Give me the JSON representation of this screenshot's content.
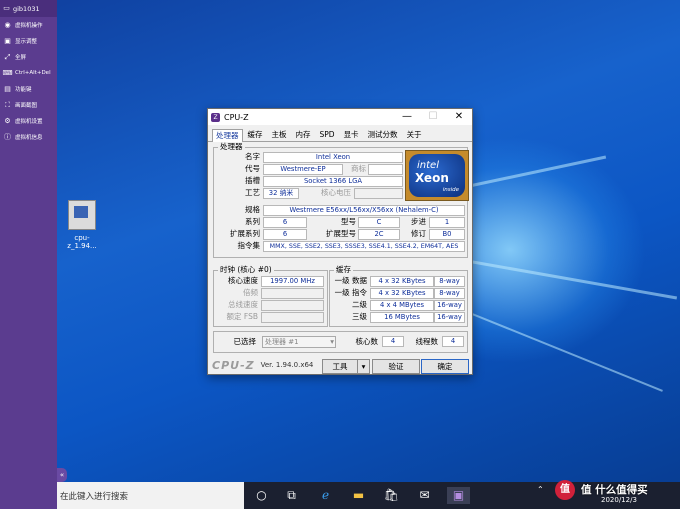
{
  "sidebar": {
    "title": "gib1031",
    "items": [
      {
        "icon": "vm-icon",
        "label": "虚拟机操作"
      },
      {
        "icon": "display-icon",
        "label": "显示调整"
      },
      {
        "icon": "fullscreen-icon",
        "label": "全屏"
      },
      {
        "icon": "keyboard-icon",
        "label": "Ctrl+Alt+Del"
      },
      {
        "icon": "function-key-icon",
        "label": "功能键"
      },
      {
        "icon": "screenshot-icon",
        "label": "画面截图"
      },
      {
        "icon": "gear-icon",
        "label": "虚拟机设置"
      },
      {
        "icon": "info-icon",
        "label": "虚拟机信息"
      }
    ],
    "handle": "«"
  },
  "desktop": {
    "icon_label": "cpu-z_1.94..."
  },
  "window": {
    "title": "CPU-Z",
    "logo": "Z",
    "controls": {
      "minimize": "—",
      "maximize": "☐",
      "close": "✕"
    },
    "tabs": [
      "处理器",
      "缓存",
      "主板",
      "内存",
      "SPD",
      "显卡",
      "测试分数",
      "关于"
    ],
    "processor": {
      "group_title": "处理器",
      "name_label": "名字",
      "name": "Intel Xeon",
      "codename_label": "代号",
      "codename": "Westmere-EP",
      "brand_label": "商标",
      "brand": "",
      "package_label": "插槽",
      "package": "Socket 1366 LGA",
      "tech_label": "工艺",
      "tech": "32 纳米",
      "voltage_label": "核心电压",
      "voltage": "",
      "spec_label": "规格",
      "spec": "Westmere E56xx/L56xx/X56xx (Nehalem-C)",
      "family_label": "系列",
      "family": "6",
      "model_label": "型号",
      "model": "C",
      "stepping_label": "步进",
      "stepping": "1",
      "extfamily_label": "扩展系列",
      "extfamily": "6",
      "extmodel_label": "扩展型号",
      "extmodel": "2C",
      "revision_label": "修订",
      "revision": "B0",
      "instructions_label": "指令集",
      "instructions": "MMX, SSE, SSE2, SSE3, SSSE3, SSE4.1, SSE4.2, EM64T, AES",
      "badge": {
        "line1": "intel",
        "line2": "Xeon",
        "line3": "inside"
      }
    },
    "clocks": {
      "group_title": "时钟 (核心 #0)",
      "core_speed_label": "核心速度",
      "core_speed": "1997.00 MHz",
      "multiplier_label": "倍频",
      "multiplier": "",
      "bus_label": "总线速度",
      "bus": "",
      "fsb_label": "额定 FSB",
      "fsb": ""
    },
    "cache": {
      "group_title": "缓存",
      "rows": [
        {
          "label": "一级 数据",
          "size": "4 x 32 KBytes",
          "way": "8-way"
        },
        {
          "label": "一级 指令",
          "size": "4 x 32 KBytes",
          "way": "8-way"
        },
        {
          "label": "二级",
          "size": "4 x 4 MBytes",
          "way": "16-way"
        },
        {
          "label": "三级",
          "size": "16 MBytes",
          "way": "16-way"
        }
      ]
    },
    "selection": {
      "label": "已选择",
      "value": "处理器 #1",
      "cores_label": "核心数",
      "cores": "4",
      "threads_label": "线程数",
      "threads": "4"
    },
    "footer": {
      "brand": "CPU-Z",
      "version": "Ver. 1.94.0.x64",
      "tools": "工具",
      "validate": "验证",
      "ok": "确定"
    }
  },
  "taskbar": {
    "search_placeholder": "在此键入进行搜索",
    "date": "2020/12/3"
  },
  "watermark": {
    "text": "值 什么值得买",
    "logo": "值"
  }
}
